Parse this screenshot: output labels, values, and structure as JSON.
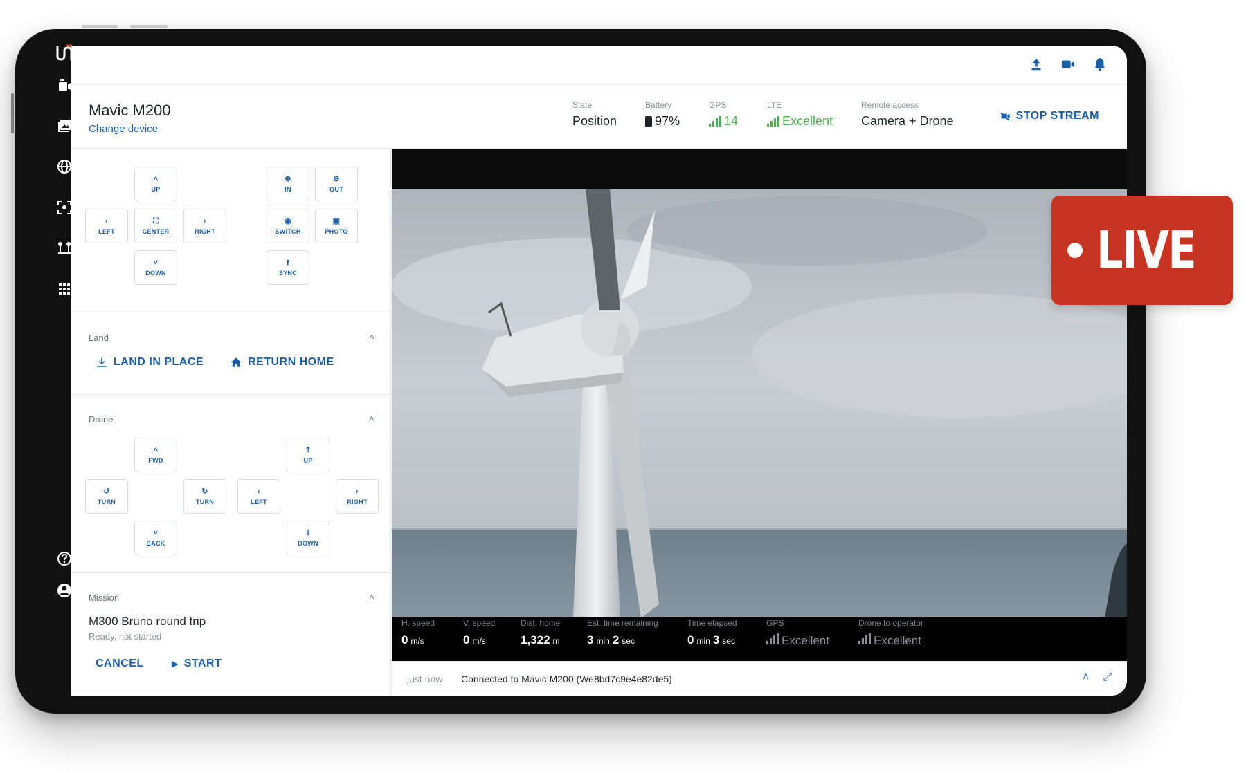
{
  "top_icons": [
    "upload-icon",
    "camera-icon",
    "bell-icon"
  ],
  "device": {
    "name": "Mavic M200",
    "change_label": "Change device"
  },
  "stats": {
    "state_label": "State",
    "state_value": "Position",
    "battery_label": "Battery",
    "battery_value": "97%",
    "gps_label": "GPS",
    "gps_value": "14",
    "lte_label": "LTE",
    "lte_value": "Excellent",
    "remote_label": "Remote access",
    "remote_value": "Camera + Drone"
  },
  "stop_stream_label": "STOP STREAM",
  "camera_controls": {
    "up": "UP",
    "left": "LEFT",
    "center": "CENTER",
    "right": "RIGHT",
    "down": "DOWN",
    "zoom_in": "IN",
    "zoom_out": "OUT",
    "switch": "SWITCH",
    "photo": "PHOTO",
    "sync": "SYNC"
  },
  "land": {
    "title": "Land",
    "land_in_place": "LAND IN PLACE",
    "return_home": "RETURN HOME"
  },
  "drone": {
    "title": "Drone",
    "fwd": "FWD",
    "turn_left": "TURN",
    "turn_right": "TURN",
    "back": "BACK",
    "up": "UP",
    "left": "LEFT",
    "right": "RIGHT",
    "down": "DOWN"
  },
  "mission": {
    "title": "Mission",
    "name": "M300 Bruno round trip",
    "status": "Ready, not started",
    "cancel": "CANCEL",
    "start": "START"
  },
  "telemetry": {
    "h_speed_label": "H. speed",
    "h_speed_value": "0",
    "h_speed_unit": "m/s",
    "v_speed_label": "V. speed",
    "v_speed_value": "0",
    "v_speed_unit": "m/s",
    "dist_home_label": "Dist. home",
    "dist_home_value": "1,322",
    "dist_home_unit": "m",
    "est_time_label": "Est. time remaining",
    "est_min": "3",
    "est_min_unit": "min",
    "est_sec": "2",
    "est_sec_unit": "sec",
    "elapsed_label": "Time elapsed",
    "elapsed_min": "0",
    "elapsed_min_unit": "min",
    "elapsed_sec": "3",
    "elapsed_sec_unit": "sec",
    "gps_label": "GPS",
    "gps_value": "Excellent",
    "operator_label": "Drone to operator",
    "operator_value": "Excellent"
  },
  "status_bar": {
    "time": "just now",
    "message": "Connected to Mavic M200 (We8bd7c9e4e82de5)"
  },
  "live_badge": "LIVE",
  "colors": {
    "accent": "#1a5fa8",
    "good": "#4caf50",
    "live": "#c73422"
  }
}
